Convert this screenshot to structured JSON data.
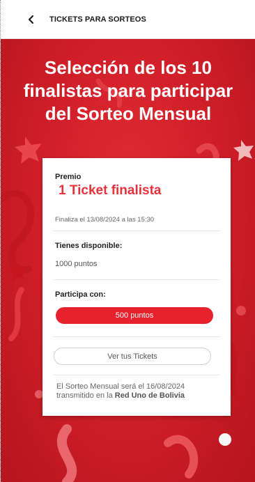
{
  "header": {
    "back_icon": "chevron-left-icon",
    "title": "TICKETS PARA SORTEOS"
  },
  "hero": {
    "title_line1": "Selección de los 10",
    "title_line2": "finalistas para participar",
    "title_line3": "del Sorteo Mensual",
    "background_color": "#d2202a"
  },
  "card": {
    "premio_label": "Premio",
    "premio_value": "1 Ticket finalista",
    "finaliza": "Finaliza el 13/08/2024 a las 15:30",
    "tienes_label": "Tienes disponible:",
    "tienes_value": "1000 puntos",
    "participa_label": "Participa con:",
    "participa_button": "500 puntos",
    "ver_tickets_button": "Ver tus Tickets",
    "note_text": "El Sorteo Mensual será el 16/08/2024 transmitido en la ",
    "note_bold": "Red Uno de Bolivia",
    "accent_color": "#e7323a"
  }
}
